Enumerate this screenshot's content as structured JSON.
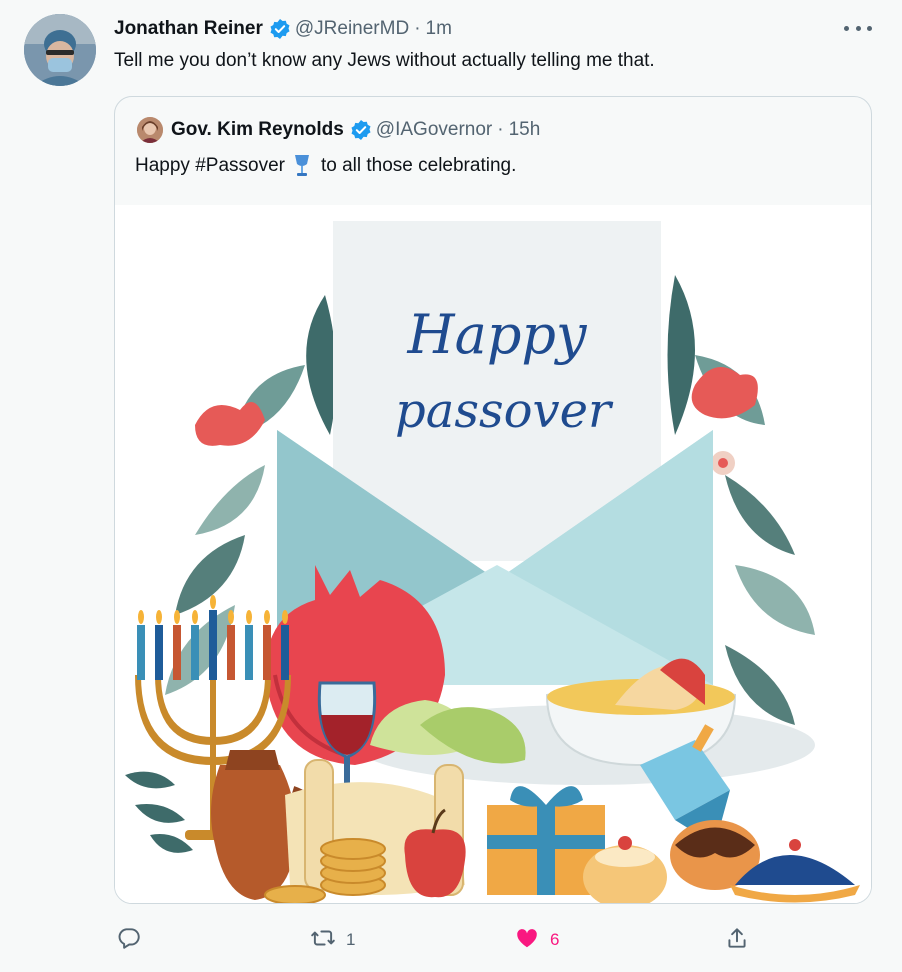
{
  "tweet": {
    "author_name": "Jonathan Reiner",
    "author_handle": "@JReinerMD",
    "separator": "·",
    "time": "1m",
    "text": "Tell me you don’t know any Jews without actually telling me that."
  },
  "quoted": {
    "author_name": "Gov. Kim Reynolds",
    "author_handle": "@IAGovernor",
    "separator": "·",
    "time": "15h",
    "text_before": "Happy #Passover",
    "text_after": "to all those celebrating.",
    "image": {
      "title_line1": "Happy",
      "title_line2": "passover"
    }
  },
  "actions": {
    "reply_count": "",
    "retweet_count": "1",
    "like_count": "6",
    "share_count": ""
  },
  "colors": {
    "verified": "#1d9bf0",
    "like_active": "#f91880",
    "secondary_text": "#536471",
    "envelope": "#9fd0d6",
    "title_blue": "#1f4b8f"
  },
  "icons": {
    "reply": "reply-icon",
    "retweet": "retweet-icon",
    "like": "heart-icon",
    "share": "share-icon",
    "more": "more-icon",
    "verified": "verified-badge-icon"
  }
}
